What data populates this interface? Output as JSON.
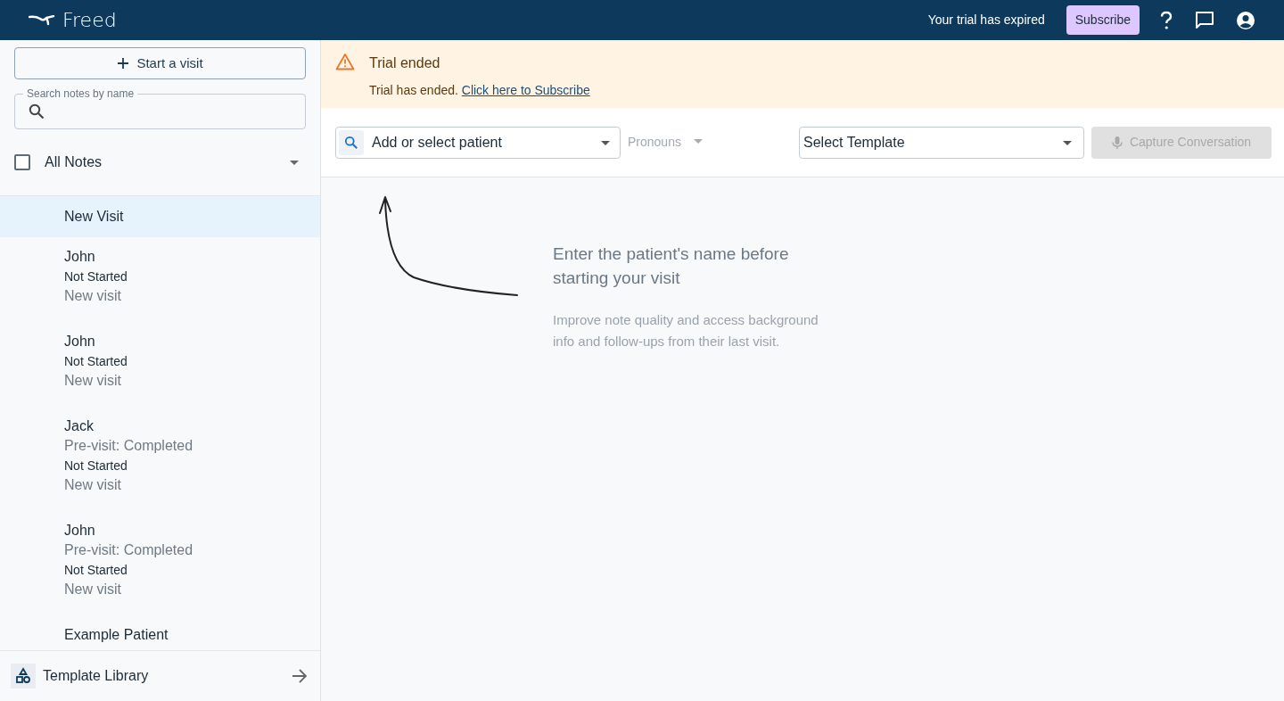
{
  "header": {
    "brand": "Freed",
    "trial_message": "Your trial has expired",
    "subscribe_button": "Subscribe"
  },
  "sidebar": {
    "start_button": "Start a visit",
    "search": {
      "label": "Search notes by name"
    },
    "filter": {
      "label": "All Notes",
      "checked": false
    },
    "notes": [
      {
        "name": "New Visit",
        "selected": true
      },
      {
        "name": "John",
        "status": "Not Started",
        "visit_type": "New visit",
        "selected": false
      },
      {
        "name": "John",
        "status": "Not Started",
        "visit_type": "New visit",
        "selected": false
      },
      {
        "name": "Jack",
        "previsit": "Pre-visit: Completed",
        "status": "Not Started",
        "visit_type": "New visit",
        "selected": false
      },
      {
        "name": "John",
        "previsit": "Pre-visit: Completed",
        "status": "Not Started",
        "visit_type": "New visit",
        "selected": false
      },
      {
        "name": "Example Patient",
        "selected": false
      }
    ],
    "footer": {
      "label": "Template Library"
    }
  },
  "banner": {
    "title": "Trial ended",
    "text": "Trial has ended.",
    "link": "Click here to Subscribe"
  },
  "toolbar": {
    "patient": {
      "placeholder": "Add or select patient"
    },
    "pronouns": {
      "placeholder": "Pronouns"
    },
    "template": {
      "value": "Select Template"
    },
    "capture_button": {
      "label": "Capture Conversation",
      "disabled": true
    }
  },
  "empty_state": {
    "heading": "Enter the patient's name before starting your visit",
    "text": "Improve note quality and access background info and follow-ups from their last visit."
  }
}
